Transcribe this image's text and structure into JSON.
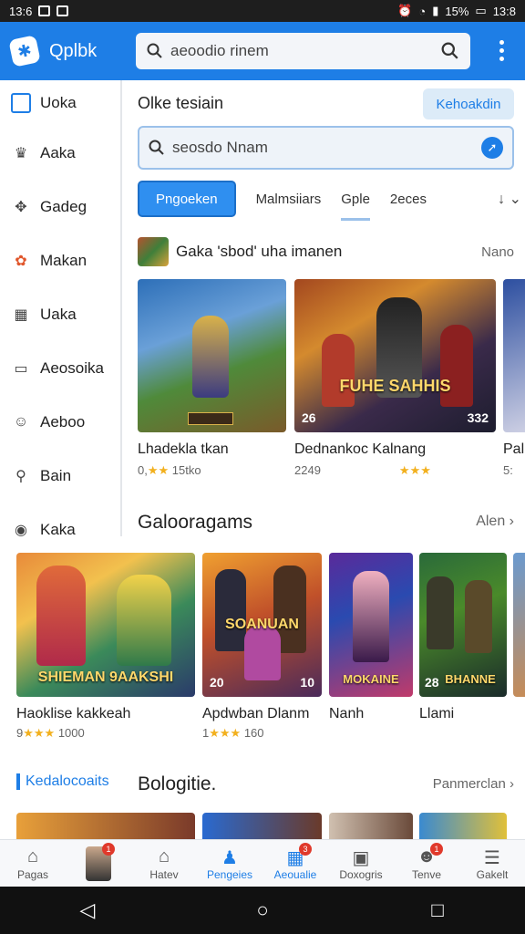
{
  "status_bar": {
    "time": "13:6",
    "battery": "15%",
    "clock_right": "13:8"
  },
  "app_bar": {
    "app_name": "Qplbk",
    "search_placeholder": "aeoodio rinem"
  },
  "sidebar": {
    "items": [
      {
        "label": "Uoka",
        "icon": "square-icon"
      },
      {
        "label": "Aaka",
        "icon": "hat-icon"
      },
      {
        "label": "Gadeg",
        "icon": "controller-icon"
      },
      {
        "label": "Makan",
        "icon": "puzzle-icon"
      },
      {
        "label": "Uaka",
        "icon": "grid-icon"
      },
      {
        "label": "Aeosoika",
        "icon": "chat-icon"
      },
      {
        "label": "Aeboo",
        "icon": "smile-icon"
      },
      {
        "label": "Bain",
        "icon": "search-icon"
      },
      {
        "label": "Kaka",
        "icon": "target-icon"
      }
    ]
  },
  "main": {
    "title": "Olke tesiain",
    "top_button": "Kehoakdin",
    "search_placeholder": "seosdo Nnam",
    "tabs": [
      "Pngoeken",
      "Malmsiiars",
      "Gple",
      "2eces"
    ],
    "section1": {
      "title": "Gaka 'sbod' uha imanen",
      "more": "Nano",
      "cards": [
        {
          "name": "Lhadekla tkan",
          "meta": "0,",
          "rating_text": "15tko",
          "badge": ""
        },
        {
          "name": "Dednankoc Kalnang",
          "meta": "2249",
          "rating_text": "",
          "badge": "26",
          "badge2": "332",
          "art_title": "FUHE SAHHIS"
        },
        {
          "name": "Pal",
          "meta": "5:",
          "rating_text": "",
          "badge": ""
        }
      ]
    }
  },
  "section2": {
    "title": "Galooragams",
    "more": "Alen",
    "cards": [
      {
        "name": "Haoklise kakkeah",
        "meta": "9",
        "rating_text": "1000",
        "art_title": "SHIEMAN 9AAKSHI",
        "badge": ""
      },
      {
        "name": "Apdwban Dlanm",
        "meta": "1",
        "rating_text": "160",
        "art_title": "SOANUAN",
        "badge": "20",
        "badge2": "10"
      },
      {
        "name": "Nanh",
        "meta": "",
        "rating_text": "",
        "art_title": "MOKAINE",
        "badge": ""
      },
      {
        "name": "Llami",
        "meta": "",
        "rating_text": "",
        "art_title": "BHANNE",
        "badge": "28"
      }
    ]
  },
  "section3": {
    "tag": "Kedalocoaits",
    "title": "Bologitie.",
    "more": "Panmerclan"
  },
  "bottom_nav": {
    "items": [
      {
        "label": "Pagas",
        "icon": "home-icon",
        "badge": ""
      },
      {
        "label": "",
        "icon": "avatar",
        "badge": "1"
      },
      {
        "label": "Hatev",
        "icon": "house-icon",
        "badge": ""
      },
      {
        "label": "Pengeies",
        "icon": "people-icon",
        "badge": "",
        "active": true
      },
      {
        "label": "Aeoualie",
        "icon": "window-icon",
        "badge": "3"
      },
      {
        "label": "Doxogris",
        "icon": "store-icon",
        "badge": ""
      },
      {
        "label": "Tenve",
        "icon": "person-icon",
        "badge": "1"
      },
      {
        "label": "Gakelt",
        "icon": "menu-icon",
        "badge": ""
      }
    ]
  },
  "colors": {
    "accent": "#1e7ee6",
    "star": "#f2b01e"
  }
}
